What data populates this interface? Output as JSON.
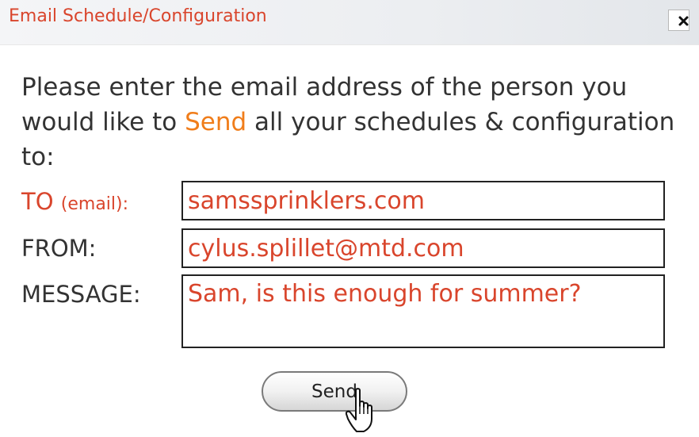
{
  "dialog": {
    "title": "Email Schedule/Configuration",
    "close_label": "×",
    "instructions": {
      "part1": "Please enter the email address of the person you would like to ",
      "highlight": "Send",
      "part2": " all your schedules & configuration to:"
    },
    "fields": {
      "to_label": "TO",
      "to_sublabel": "(email):",
      "to_value": "samssprinklers.com",
      "from_label": "FROM:",
      "from_value": "cylus.splillet@mtd.com",
      "message_label": "MESSAGE:",
      "message_value": "Sam, is this enough for summer?"
    },
    "send_label": "Send"
  },
  "colors": {
    "accent_red": "#d9452c",
    "highlight_orange": "#f07d1a",
    "text_dark": "#333333"
  },
  "icons": {
    "close": "close-icon",
    "cursor": "hand-pointer-cursor-icon"
  }
}
